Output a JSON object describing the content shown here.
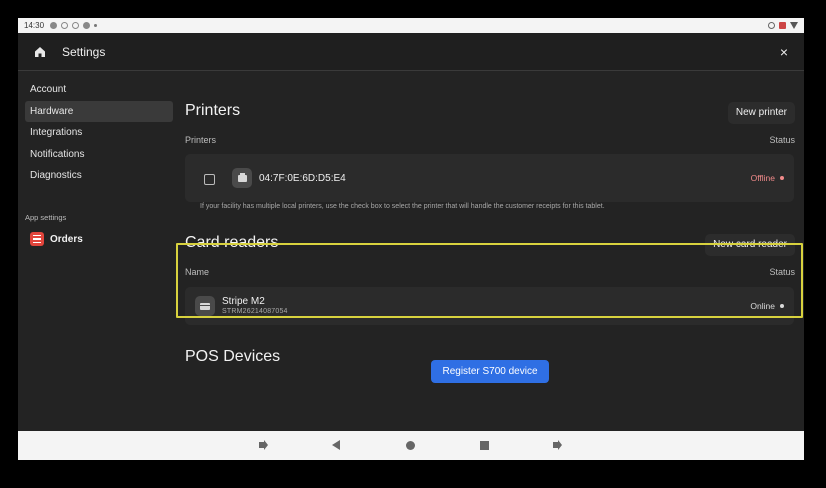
{
  "status_bar": {
    "time": "14:30"
  },
  "header": {
    "title": "Settings",
    "close_label": "×"
  },
  "sidebar": {
    "items": [
      {
        "label": "Account"
      },
      {
        "label": "Hardware",
        "active": true
      },
      {
        "label": "Integrations"
      },
      {
        "label": "Notifications"
      },
      {
        "label": "Diagnostics"
      }
    ],
    "section_label": "App settings",
    "app_item": {
      "label": "Orders"
    }
  },
  "printers": {
    "title": "Printers",
    "new_button": "New printer",
    "col_name": "Printers",
    "col_status": "Status",
    "device": {
      "name": "04:7F:0E:6D:D5:E4",
      "status": "Offline"
    },
    "hint": "If your facility has multiple local printers, use the check box to select the printer that will handle the customer receipts for this tablet."
  },
  "card_readers": {
    "title": "Card readers",
    "new_button": "New card reader",
    "col_name": "Name",
    "col_status": "Status",
    "device": {
      "name": "Stripe M2",
      "serial": "STRM26214087054",
      "status": "Online"
    }
  },
  "pos_devices": {
    "title": "POS Devices",
    "register_button": "Register S700 device"
  },
  "colors": {
    "offline": "#f08a8a",
    "online": "#d9d9d9",
    "primary": "#2f6fe4",
    "highlight": "#d8d23e"
  }
}
